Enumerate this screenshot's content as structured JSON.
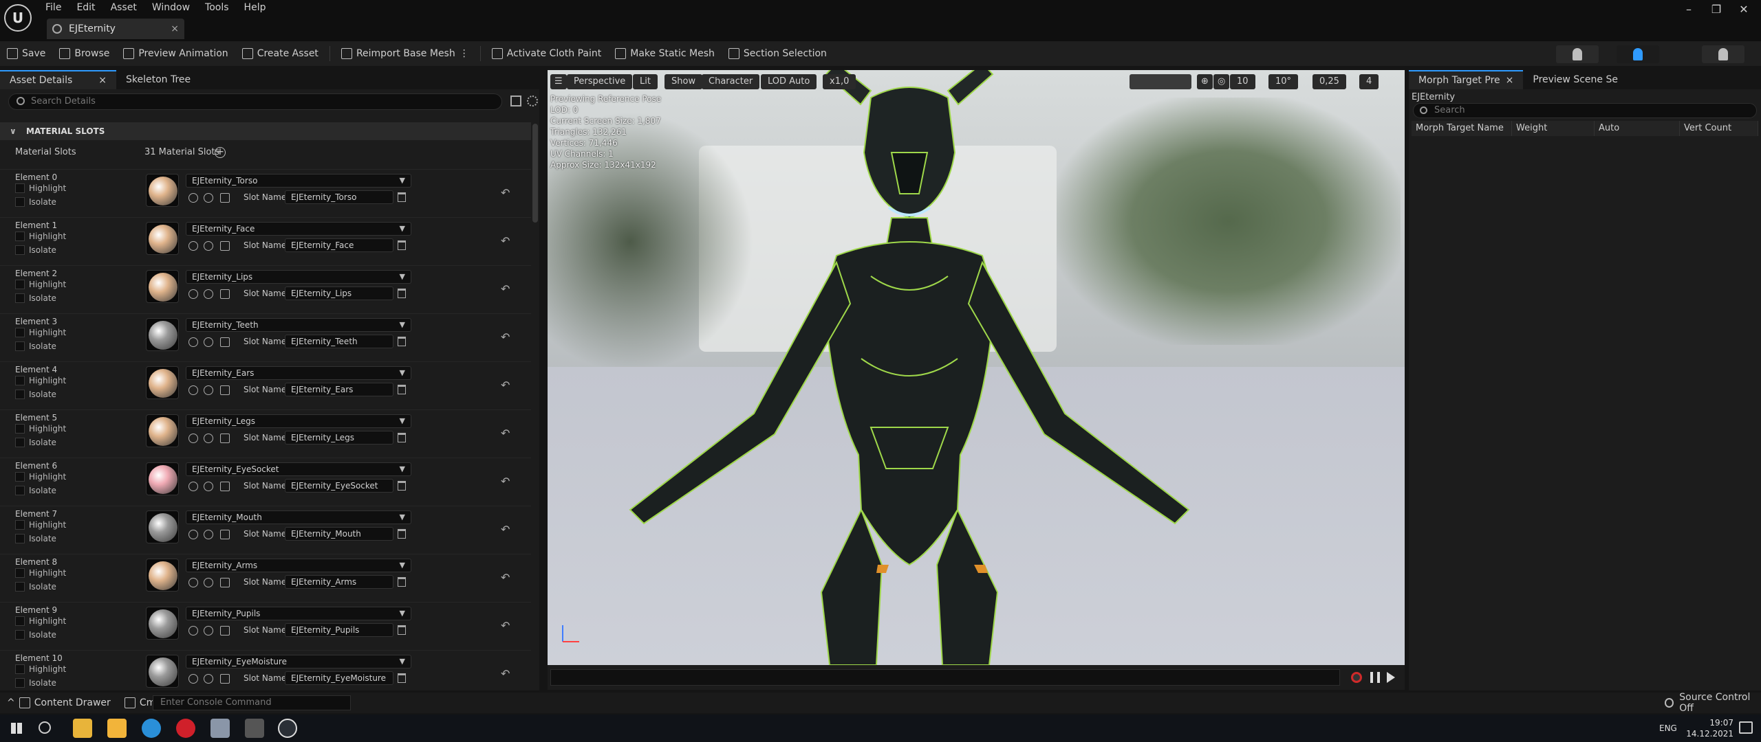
{
  "menu": {
    "items": [
      "File",
      "Edit",
      "Asset",
      "Window",
      "Tools",
      "Help"
    ]
  },
  "doc_tab": {
    "label": "EJEternity",
    "close": "×"
  },
  "window_controls": {
    "minimize": "–",
    "restore": "❐",
    "close": "✕"
  },
  "toolbar": {
    "save": "Save",
    "browse": "Browse",
    "preview_animation": "Preview Animation",
    "create_asset": "Create Asset",
    "reimport": "Reimport Base Mesh",
    "activate_cloth": "Activate Cloth Paint",
    "make_static": "Make Static Mesh",
    "section_selection": "Section Selection"
  },
  "left_panel": {
    "tabs": [
      {
        "label": "Asset Details",
        "close": "×"
      },
      {
        "label": "Skeleton Tree"
      }
    ],
    "search_placeholder": "Search Details",
    "section_title": "MATERIAL SLOTS",
    "slots_label": "Material Slots",
    "slots_count": "31 Material Slots",
    "highlight": "Highlight",
    "isolate": "Isolate",
    "slot_name_label": "Slot Name",
    "elements": [
      {
        "label": "Element 0",
        "material": "EJEternity_Torso",
        "slot": "EJEternity_Torso",
        "color": "#e0b48c"
      },
      {
        "label": "Element 1",
        "material": "EJEternity_Face",
        "slot": "EJEternity_Face",
        "color": "#e0b48c"
      },
      {
        "label": "Element 2",
        "material": "EJEternity_Lips",
        "slot": "EJEternity_Lips",
        "color": "#e0b48c"
      },
      {
        "label": "Element 3",
        "material": "EJEternity_Teeth",
        "slot": "EJEternity_Teeth",
        "color": "#9a9a9a"
      },
      {
        "label": "Element 4",
        "material": "EJEternity_Ears",
        "slot": "EJEternity_Ears",
        "color": "#e0b48c"
      },
      {
        "label": "Element 5",
        "material": "EJEternity_Legs",
        "slot": "EJEternity_Legs",
        "color": "#e0b48c"
      },
      {
        "label": "Element 6",
        "material": "EJEternity_EyeSocket",
        "slot": "EJEternity_EyeSocket",
        "color": "#f0aab4"
      },
      {
        "label": "Element 7",
        "material": "EJEternity_Mouth",
        "slot": "EJEternity_Mouth",
        "color": "#9a9a9a"
      },
      {
        "label": "Element 8",
        "material": "EJEternity_Arms",
        "slot": "EJEternity_Arms",
        "color": "#e0b48c"
      },
      {
        "label": "Element 9",
        "material": "EJEternity_Pupils",
        "slot": "EJEternity_Pupils",
        "color": "#9a9a9a"
      },
      {
        "label": "Element 10",
        "material": "EJEternity_EyeMoisture",
        "slot": "EJEternity_EyeMoisture",
        "color": "#9a9a9a"
      }
    ]
  },
  "viewport": {
    "perspective": "Perspective",
    "lit": "Lit",
    "show": "Show",
    "character": "Character",
    "lod": "LOD Auto",
    "speed": "x1,0",
    "grid": "10",
    "angle": "10°",
    "scale": "0,25",
    "camera_speed": "4",
    "stats": [
      "Previewing Reference Pose",
      "LOD: 0",
      "Current Screen Size: 1,807",
      "Triangles: 132,261",
      "Vertices: 71,446",
      "UV Channels: 1",
      "Approx Size: 132x41x192"
    ]
  },
  "right_panel": {
    "tabs": [
      {
        "label": "Morph Target Pre",
        "close": "×"
      },
      {
        "label": "Preview Scene Se"
      }
    ],
    "asset_name": "EJEternity",
    "search_placeholder": "Search",
    "columns": [
      "Morph Target Name",
      "Weight",
      "Auto",
      "Vert Count"
    ]
  },
  "statusbar": {
    "content_drawer": "Content Drawer",
    "cmd": "Cmd",
    "console_placeholder": "Enter Console Command",
    "source_control": "Source Control Off"
  },
  "taskbar": {
    "lang": "ENG",
    "time": "19:07",
    "date": "14.12.2021"
  }
}
